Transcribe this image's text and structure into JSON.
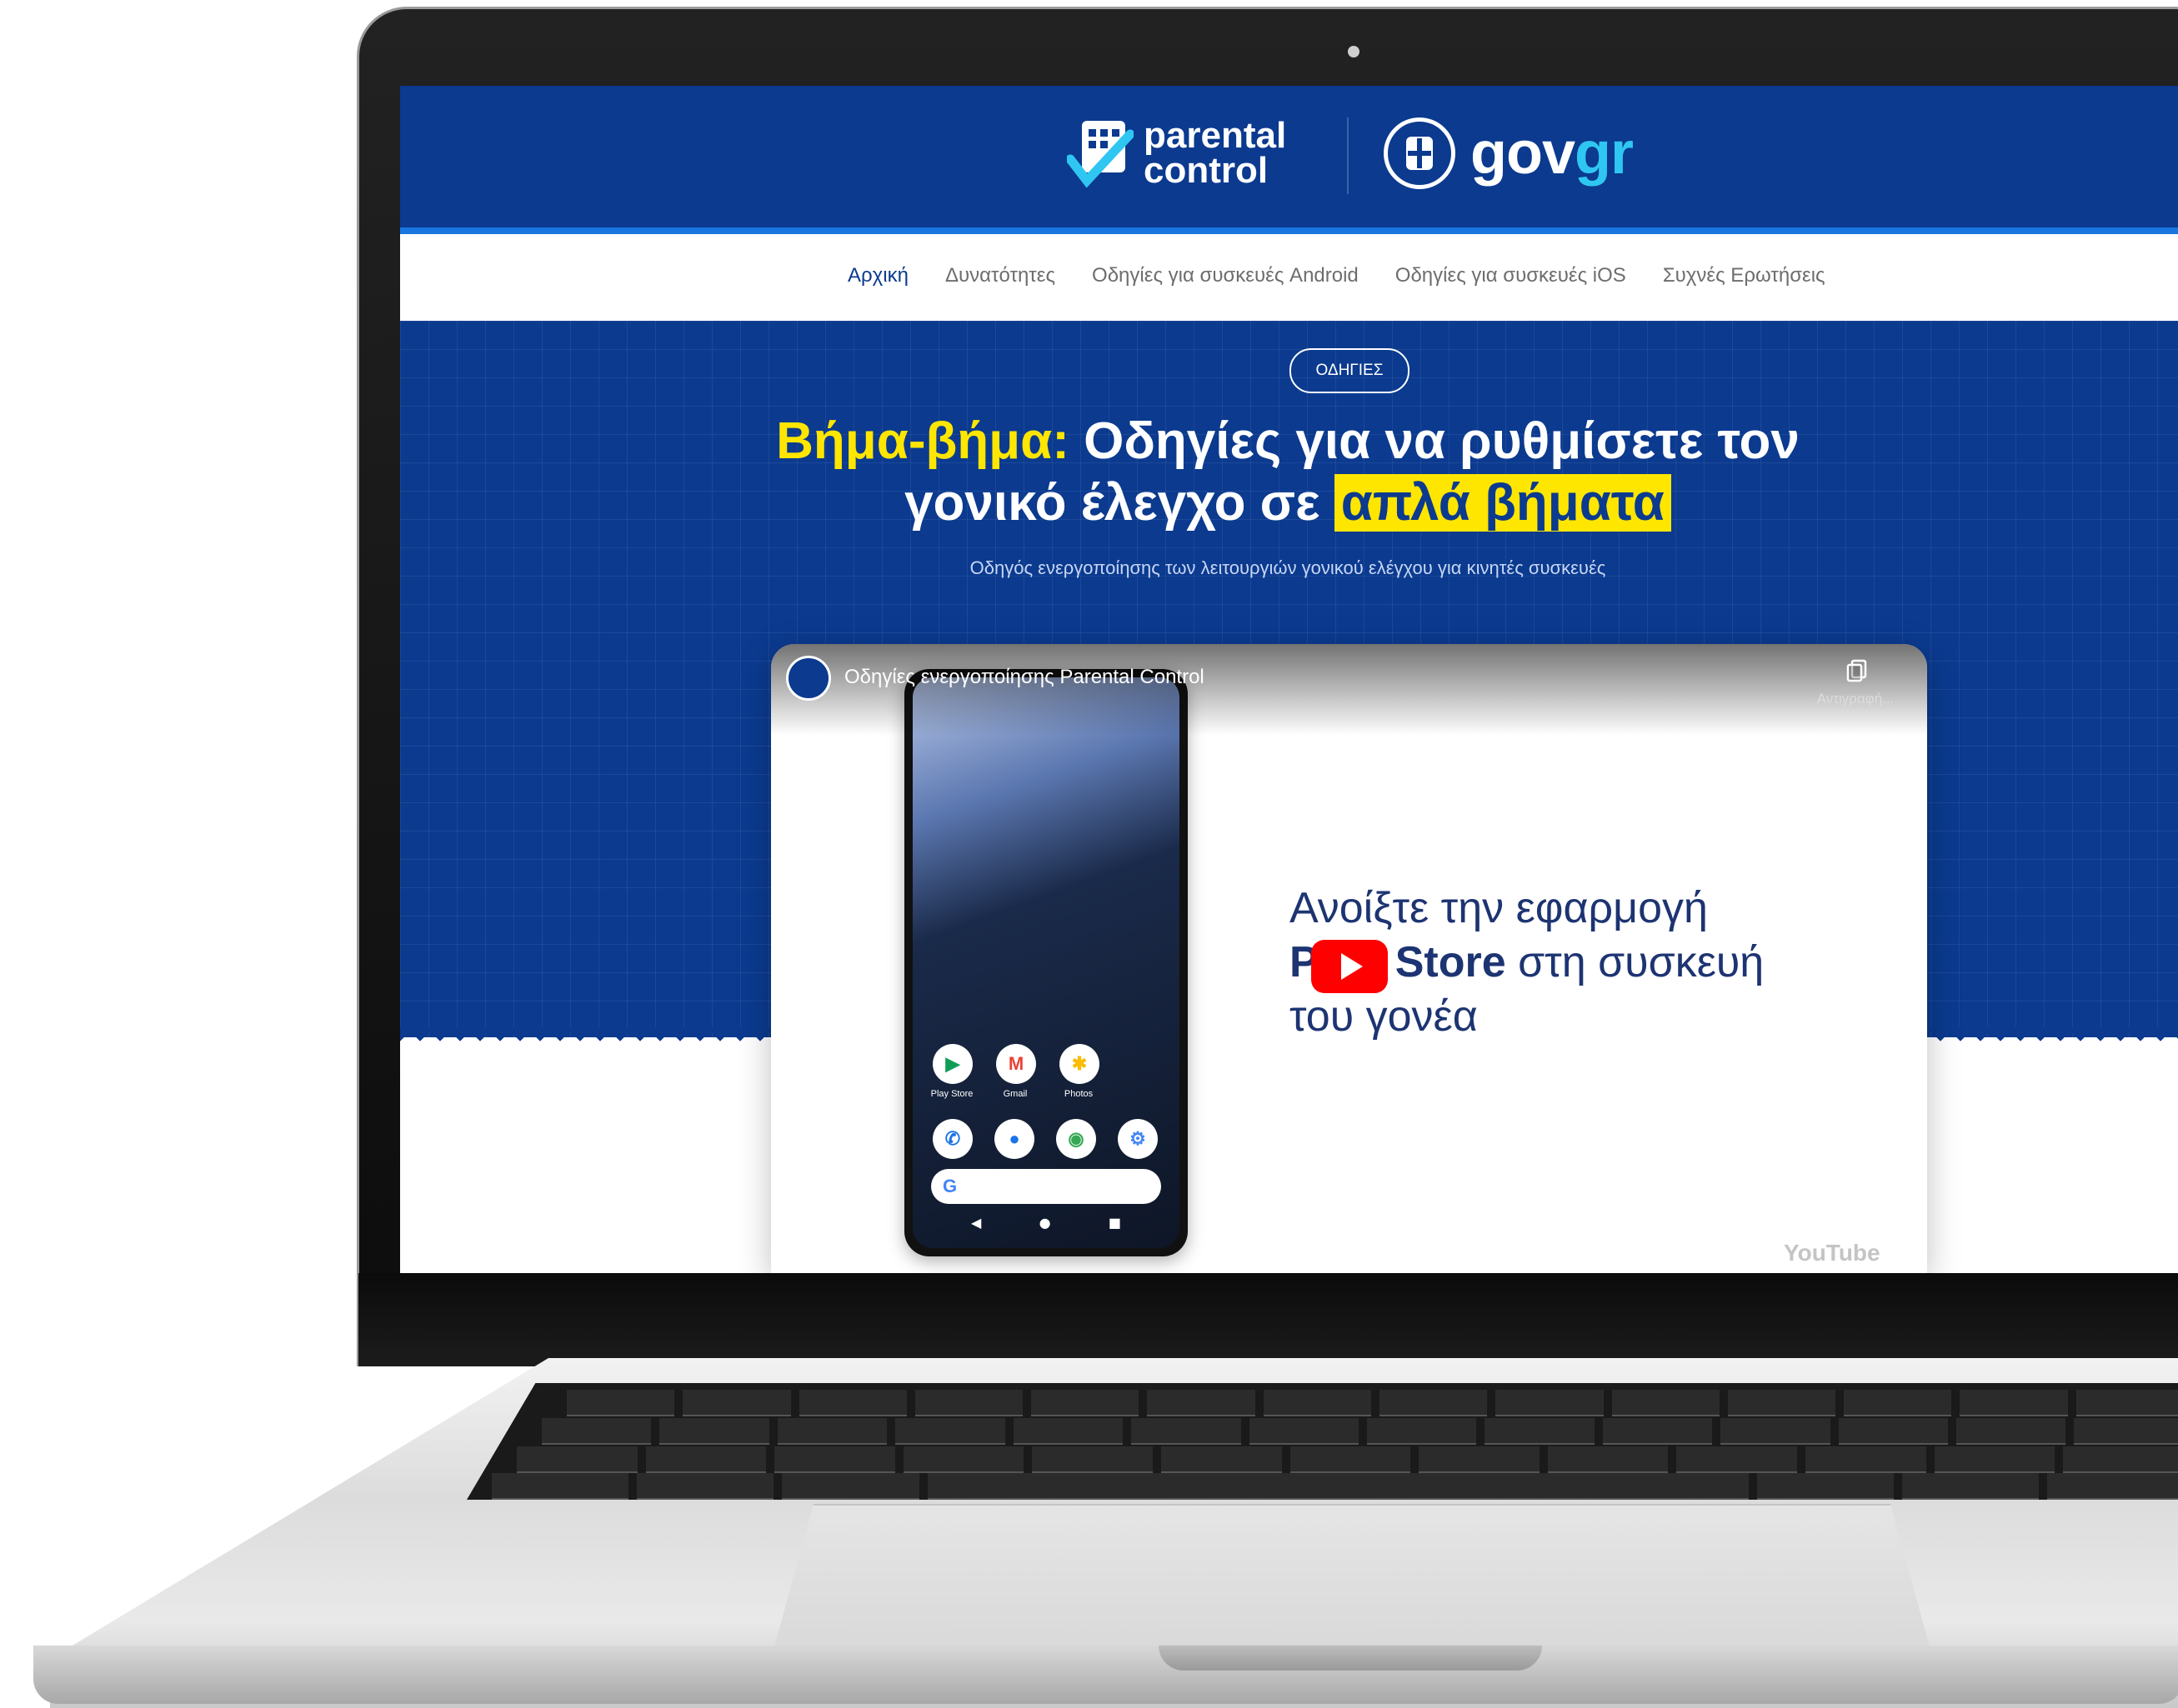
{
  "header": {
    "parental_logo_line1": "parental",
    "parental_logo_line2": "control",
    "gov_logo_main": "gov",
    "gov_logo_accent": "gr",
    "colors": {
      "primary": "#0b3a8f",
      "accent": "#2fc6f2",
      "highlight": "#ffe600"
    }
  },
  "nav": {
    "items": [
      {
        "label": "Αρχική",
        "active": true
      },
      {
        "label": "Δυνατότητες",
        "active": false
      },
      {
        "label": "Οδηγίες για συσκευές Android",
        "active": false
      },
      {
        "label": "Οδηγίες για συσκευές iOS",
        "active": false
      },
      {
        "label": "Συχνές Ερωτήσεις",
        "active": false
      }
    ]
  },
  "hero": {
    "badge": "ΟΔΗΓΙΕΣ",
    "title_highlight": "Βήμα-βήμα:",
    "title_main": "Οδηγίες για να ρυθμίσετε τον γονικό έλεγχο σε",
    "title_marked": "απλά βήματα",
    "subtitle": "Οδηγός ενεργοποίησης των λειτουργιών γονικού ελέγχου για κινητές συσκευές"
  },
  "video": {
    "title": "Οδηγίες ενεργοποίησης Parental Control",
    "copy_label": "Αντιγραφή...",
    "caption_line1": "Ανοίξτε την εφαρμογή",
    "caption_bold_prefix": "P",
    "caption_bold_suffix": "Store",
    "caption_line2_rest": "στη συσκευή",
    "caption_line3": "του γονέα",
    "brand": "YouTube",
    "phone_apps_row1": [
      {
        "label": "Play Store",
        "icon": "play-store-icon"
      },
      {
        "label": "Gmail",
        "icon": "gmail-icon"
      },
      {
        "label": "Photos",
        "icon": "photos-icon"
      }
    ],
    "phone_apps_row2": [
      {
        "icon": "phone-icon"
      },
      {
        "icon": "messages-icon"
      },
      {
        "icon": "chrome-icon"
      },
      {
        "icon": "settings-icon"
      }
    ],
    "search_letter": "G"
  }
}
